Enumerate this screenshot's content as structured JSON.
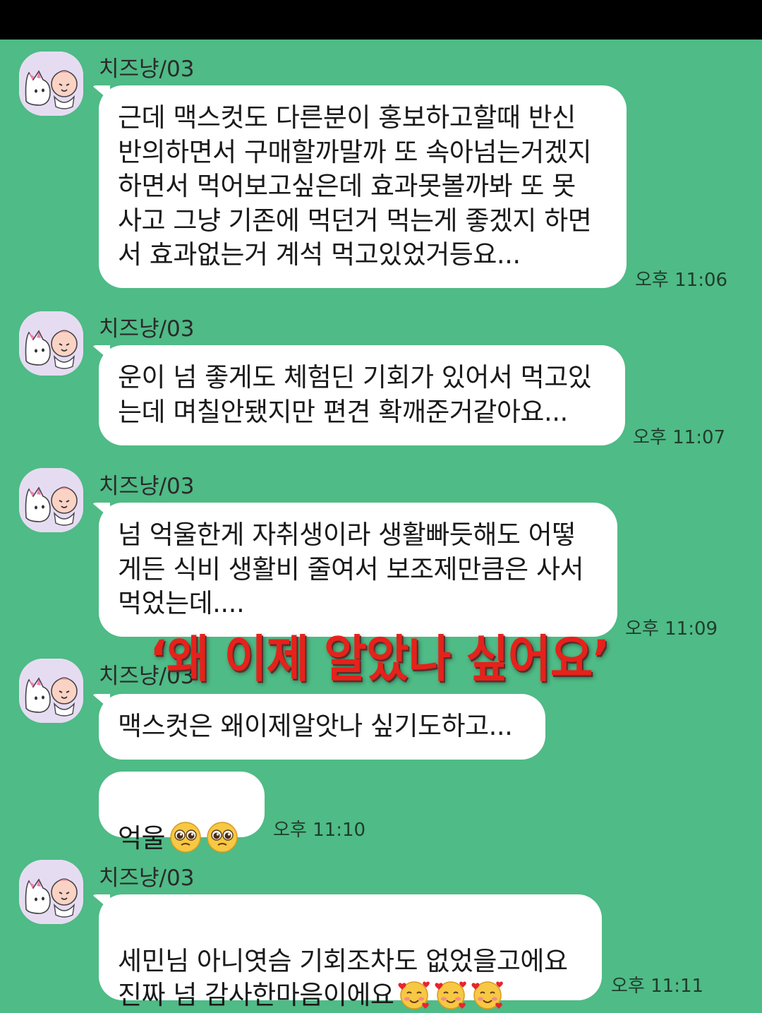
{
  "messages": [
    {
      "sender": "치즈냥/03",
      "text": "근데 맥스컷도 다른분이 홍보하고할때 반신\n반의하면서 구매할까말까 또 속아넘는거겠지\n하면서 먹어보고싶은데 효과못볼까봐 또 못\n사고 그냥 기존에 먹던거 먹는게 좋겠지 하면\n서 효과없는거 계석 먹고있었거등요...",
      "time": "오후 11:06"
    },
    {
      "sender": "치즈냥/03",
      "text": "운이 넘 좋게도 체험딘 기회가 있어서 먹고있\n는데 며칠안됐지만 편견 확깨준거같아요...",
      "time": "오후 11:07"
    },
    {
      "sender": "치즈냥/03",
      "text": "넘 억울한게 자취생이라 생활빠듯해도 어떻\n게든 식비 생활비 줄여서 보조제만큼은 사서\n먹었는데....",
      "time": "오후 11:09"
    },
    {
      "sender": "치즈냥/03",
      "text": "맥스컷은 왜이제알앗나 싶기도하고...",
      "text2": "억울",
      "time": "오후 11:10"
    },
    {
      "sender": "치즈냥/03",
      "text": "세민님 아니엿슴 기회조차도 없었을고에요\n진짜 넘 감사한마음이에요",
      "time": "오후 11:11"
    }
  ],
  "overlay_caption": "‘왜 이제 알았나 싶어요’",
  "icons": {
    "avatar": "cat-and-peach-avatar-icon",
    "pleading_emoji": "pleading-face-emoji",
    "hearts_emoji": "smiling-face-with-hearts-emoji"
  },
  "colors": {
    "background": "#4fbb86",
    "bubble": "#ffffff",
    "caption": "#e5221b"
  }
}
